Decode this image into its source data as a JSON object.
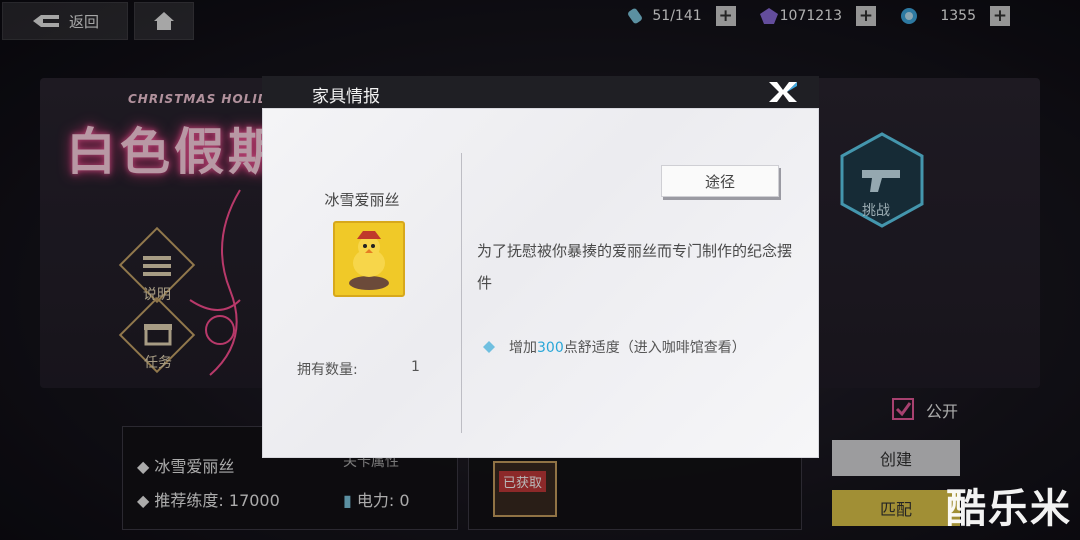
{
  "topbar": {
    "back_label": "返回",
    "resources": [
      {
        "icon": "stamina-vial-icon",
        "value": "51/141",
        "color": "#7fc8e0"
      },
      {
        "icon": "purple-crystal-icon",
        "value": "1071213",
        "color": "#8a6bd8"
      },
      {
        "icon": "blue-gem-icon",
        "value": "1355",
        "color": "#3fa8e0"
      }
    ]
  },
  "background": {
    "event_subtitle": "CHRISTMAS HOLIDAY",
    "event_title": "白色假期",
    "side_buttons": [
      {
        "label": "说明",
        "icon": "list-icon"
      },
      {
        "label": "任务",
        "icon": "gift-box-icon"
      }
    ],
    "challenge_label": "挑战",
    "public_label": "公开",
    "create_label": "创建",
    "match_label": "匹配",
    "card_name": "冰雪爱丽丝",
    "recommend_label": "推荐练度:",
    "recommend_value": "17000",
    "power_label": "电力:",
    "power_value": "0",
    "obtained_badge": "已获取",
    "partial_text": "关卡属性"
  },
  "dialog": {
    "title": "家具情报",
    "item_name": "冰雪爱丽丝",
    "count_label": "拥有数量:",
    "count_value": "1",
    "source_button": "途径",
    "description": "为了抚慰被你暴揍的爱丽丝而专门制作的纪念摆件",
    "effect_prefix": "增加",
    "effect_number": "300",
    "effect_suffix": "点舒适度（进入咖啡馆查看）"
  },
  "watermark": "酷乐米"
}
